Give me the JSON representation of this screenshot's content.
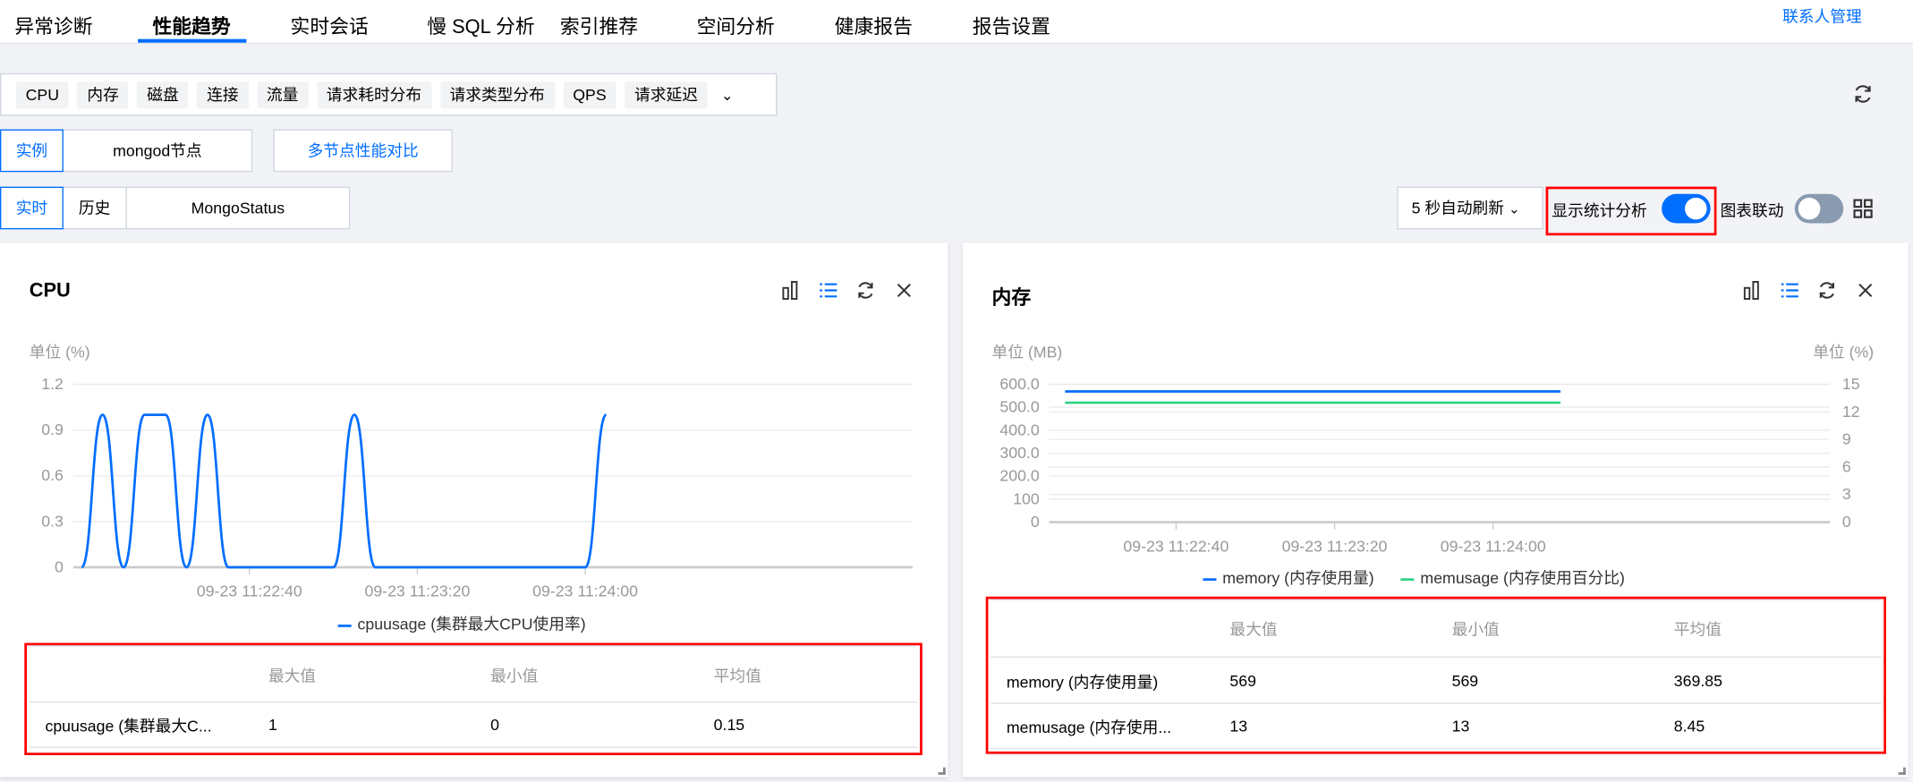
{
  "tabs": [
    "异常诊断",
    "性能趋势",
    "实时会话",
    "慢 SQL 分析",
    "索引推荐",
    "空间分析",
    "健康报告",
    "报告设置"
  ],
  "active_tab": "性能趋势",
  "contact_link": "联系人管理",
  "metric_tags": [
    "CPU",
    "内存",
    "磁盘",
    "连接",
    "流量",
    "请求耗时分布",
    "请求类型分布",
    "QPS",
    "请求延迟"
  ],
  "scope_segments": {
    "instance": "实例",
    "node": "mongod节点",
    "compare": "多节点性能对比"
  },
  "mode_segments": {
    "realtime": "实时",
    "history": "历史",
    "mongostatus": "MongoStatus"
  },
  "controls": {
    "auto_refresh": "5 秒自动刷新",
    "show_stats_label": "显示统计分析",
    "show_stats_on": true,
    "link_charts_label": "图表联动",
    "link_charts_on": false
  },
  "colors": {
    "accent": "#006eff",
    "memusage": "#2dd184",
    "highlight": "#ff0000"
  },
  "stats_headers": {
    "max": "最大值",
    "min": "最小值",
    "avg": "平均值"
  },
  "cpu_panel": {
    "title": "CPU",
    "stats": [
      {
        "name": "cpuusage (集群最大C...",
        "max": "1",
        "min": "0",
        "avg": "0.15"
      }
    ]
  },
  "mem_panel": {
    "title": "内存",
    "stats": [
      {
        "name": "memory (内存使用量)",
        "max": "569",
        "min": "569",
        "avg": "369.85"
      },
      {
        "name": "memusage (内存使用...",
        "max": "13",
        "min": "13",
        "avg": "8.45"
      }
    ]
  },
  "chart_data": [
    {
      "type": "line",
      "title": "CPU",
      "ylabel": "单位 (%)",
      "ylim": [
        0,
        1.2
      ],
      "yticks": [
        "0",
        "0.3",
        "0.6",
        "0.9",
        "1.2"
      ],
      "ytick_values": [
        0,
        0.3,
        0.6,
        0.9,
        1.2
      ],
      "xlim": [
        "11:21:58",
        "11:25:18"
      ],
      "xticks": [
        {
          "t": "11:22:40",
          "label": "09-23 11:22:40"
        },
        {
          "t": "11:23:20",
          "label": "09-23 11:23:20"
        },
        {
          "t": "11:24:00",
          "label": "09-23 11:24:00"
        }
      ],
      "series": [
        {
          "name": "cpuusage (集群最大CPU使用率)",
          "color": "#006eff",
          "x": [
            "11:22:00",
            "11:22:05",
            "11:22:10",
            "11:22:15",
            "11:22:20",
            "11:22:25",
            "11:22:30",
            "11:22:35",
            "11:22:40",
            "11:22:45",
            "11:22:50",
            "11:22:55",
            "11:23:00",
            "11:23:05",
            "11:23:10",
            "11:23:15",
            "11:23:20",
            "11:23:25",
            "11:23:30",
            "11:23:35",
            "11:23:40",
            "11:23:45",
            "11:23:50",
            "11:23:55",
            "11:24:00",
            "11:24:05"
          ],
          "values": [
            0,
            1,
            0,
            1,
            1,
            0,
            1,
            0,
            0,
            0,
            0,
            0,
            0,
            1,
            0,
            0,
            0,
            0,
            0,
            0,
            0,
            0,
            0,
            0,
            0,
            1
          ]
        }
      ]
    },
    {
      "type": "line",
      "title": "内存",
      "ylabel": "单位 (MB)",
      "y2label": "单位 (%)",
      "ylim": [
        0,
        600
      ],
      "yticks": [
        "0",
        "100",
        "200.0",
        "300.0",
        "400.0",
        "500.0",
        "600.0"
      ],
      "ytick_values": [
        0,
        100,
        200,
        300,
        400,
        500,
        600
      ],
      "y2lim": [
        0,
        15
      ],
      "y2ticks": [
        "0",
        "3",
        "6",
        "9",
        "12",
        "15"
      ],
      "y2tick_values": [
        0,
        3,
        6,
        9,
        12,
        15
      ],
      "xlim": [
        "11:22:08",
        "11:25:25"
      ],
      "xticks": [
        {
          "t": "11:22:40",
          "label": "09-23 11:22:40"
        },
        {
          "t": "11:23:20",
          "label": "09-23 11:23:20"
        },
        {
          "t": "11:24:00",
          "label": "09-23 11:24:00"
        }
      ],
      "series": [
        {
          "name": "memory (内存使用量)",
          "color": "#006eff",
          "axis": "left",
          "x": [
            "11:22:12",
            "11:24:17"
          ],
          "values": [
            569,
            569
          ]
        },
        {
          "name": "memusage (内存使用百分比)",
          "color": "#2dd184",
          "axis": "right",
          "x": [
            "11:22:12",
            "11:24:17"
          ],
          "values": [
            13,
            13
          ]
        }
      ]
    }
  ]
}
